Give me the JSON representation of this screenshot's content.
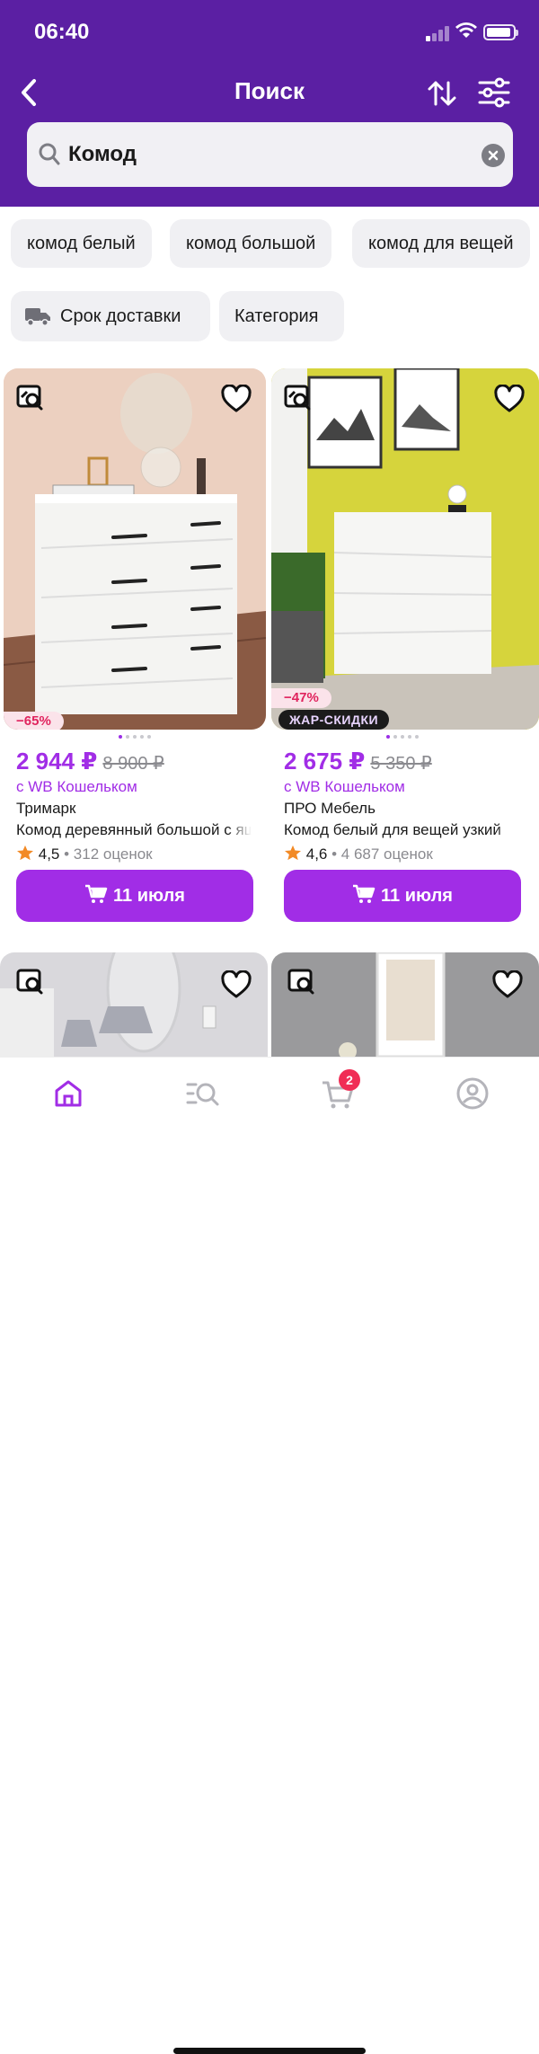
{
  "status": {
    "time": "06:40"
  },
  "header": {
    "title": "Поиск",
    "search_value": "Комод",
    "icons": [
      "chevron-left-icon",
      "sort-icon",
      "filter-icon",
      "search-icon",
      "clear-icon"
    ]
  },
  "suggestions": [
    "комод белый",
    "комод большой",
    "комод для вещей"
  ],
  "filters": {
    "delivery": "Срок доставки",
    "category": "Категория"
  },
  "products": [
    {
      "discount": "−65%",
      "hot_label": "",
      "price": "2 944 ₽",
      "old_price": "8 900 ₽",
      "wallet": "с WB Кошельком",
      "brand": "Тримарк",
      "name": "Комод деревянный большой с ящиками",
      "rating": "4,5",
      "reviews": "312 оценок",
      "button": "11 июля"
    },
    {
      "discount": "−47%",
      "hot_label": "ЖАР-СКИДКИ",
      "price": "2 675 ₽",
      "old_price": "5 350 ₽",
      "wallet": "с WB Кошельком",
      "brand": "ПРО Мебель",
      "name": "Комод белый для вещей узкий",
      "rating": "4,6",
      "reviews": "4 687 оценок",
      "button": "11 июля"
    }
  ],
  "cart": {
    "badge": "2"
  },
  "colors": {
    "brand": "#5b1fa3",
    "accent": "#a12de6",
    "discount": "#e0245e"
  }
}
